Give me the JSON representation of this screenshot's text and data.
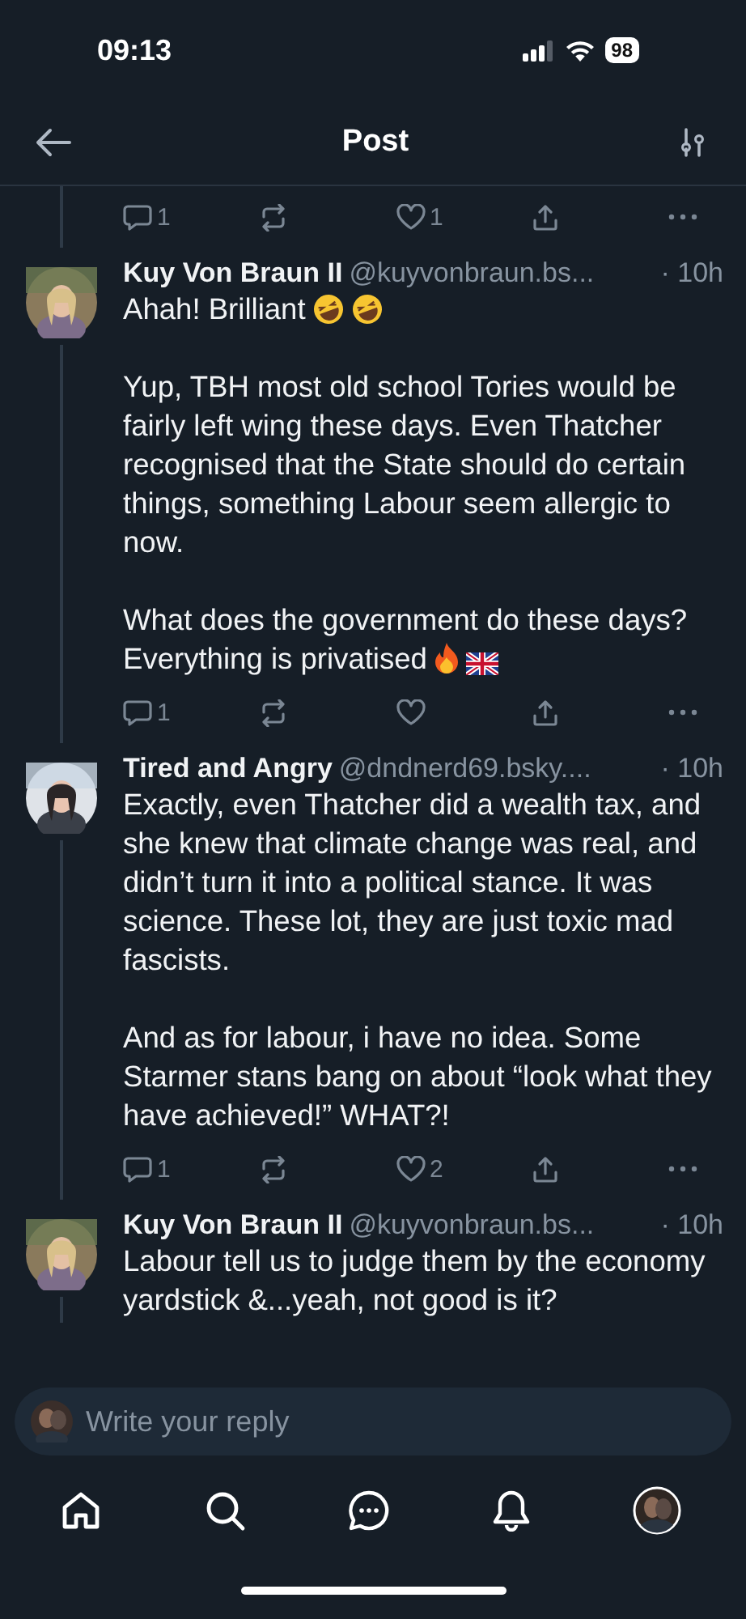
{
  "status_bar": {
    "time": "09:13",
    "battery": "98"
  },
  "header": {
    "title": "Post"
  },
  "previous_actions": {
    "replies": "1",
    "likes": "1"
  },
  "posts": [
    {
      "name": "Kuy Von Braun II",
      "handle": "@kuyvonbraun.bs...",
      "time": "· 10h",
      "paragraphs": [
        {
          "text": "Ahah! Brilliant",
          "emojis": [
            {
              "kind": "rofl"
            },
            {
              "kind": "rofl"
            }
          ]
        },
        {
          "text": "Yup, TBH most old school Tories would be fairly left wing these days. Even Thatcher recognised that the State should do certain things, something Labour seem allergic to now."
        },
        {
          "text": "What does the government do these days? Everything is privatised",
          "emojis": [
            {
              "kind": "fire"
            },
            {
              "kind": "uk-flag"
            }
          ]
        }
      ],
      "actions": {
        "replies": "1"
      }
    },
    {
      "name": "Tired and Angry",
      "handle": "@dndnerd69.bsky....",
      "time": "· 10h",
      "paragraphs": [
        {
          "text": "Exactly, even Thatcher did a wealth tax, and she knew that climate change was real, and didn’t turn it into a political stance. It was science. These lot, they are just toxic mad fascists."
        },
        {
          "text": "And as for labour, i have no idea. Some Starmer stans bang on about “look what they have achieved!” WHAT?!"
        }
      ],
      "actions": {
        "replies": "1",
        "likes": "2"
      }
    },
    {
      "name": "Kuy Von Braun II",
      "handle": "@kuyvonbraun.bs...",
      "time": "· 10h",
      "paragraphs": [
        {
          "text": "Labour tell us to judge them by the economy yardstick &...yeah, not good is it?"
        }
      ]
    }
  ],
  "reply_bar": {
    "placeholder": "Write your reply"
  }
}
